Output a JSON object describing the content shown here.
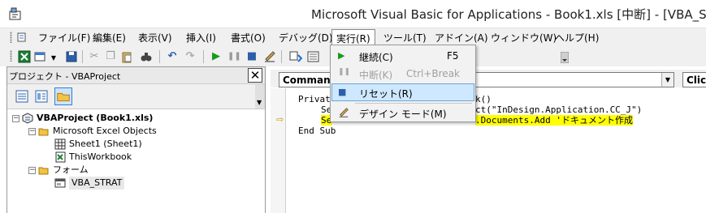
{
  "window": {
    "title": "Microsoft Visual Basic for Applications - Book1.xls [中断] - [VBA_ST"
  },
  "menubar": {
    "items": [
      {
        "label": "ファイル(F)"
      },
      {
        "label": "編集(E)"
      },
      {
        "label": "表示(V)"
      },
      {
        "label": "挿入(I)"
      },
      {
        "label": "書式(O)"
      },
      {
        "label": "デバッグ(D)"
      },
      {
        "label": "実行(R)"
      },
      {
        "label": "ツール(T)"
      },
      {
        "label": "アドイン(A)"
      },
      {
        "label": "ウィンドウ(W)"
      },
      {
        "label": "ヘルプ(H)"
      }
    ],
    "open_menu": "実行(R)"
  },
  "run_menu": {
    "items": [
      {
        "label": "継続(C)",
        "shortcut": "F5",
        "enabled": true,
        "icon": "play-icon"
      },
      {
        "label": "中断(K)",
        "shortcut": "Ctrl+Break",
        "enabled": false,
        "icon": "pause-icon"
      },
      {
        "label": "リセット(R)",
        "shortcut": "",
        "enabled": true,
        "icon": "stop-icon",
        "highlighted": true
      },
      {
        "label": "デザイン モード(M)",
        "shortcut": "",
        "enabled": true,
        "icon": "design-mode-icon"
      }
    ]
  },
  "project_panel": {
    "title": "プロジェクト - VBAProject",
    "tree": {
      "project": "VBAProject (Book1.xls)",
      "excel_objects_folder": "Microsoft Excel Objects",
      "sheet1": "Sheet1 (Sheet1)",
      "thisworkbook": "ThisWorkbook",
      "forms_folder": "フォーム",
      "form1": "VBA_STRAT"
    }
  },
  "code_window": {
    "object_combo": "Command",
    "procedure_combo": "Clic",
    "lines": [
      "Privat",
      "Se",
      "Se",
      "End Sub"
    ],
    "line_tails": [
      "k()",
      "ct(\"InDesign.Application.CC_J\")",
      ".Documents.Add 'ドキュメント作成"
    ]
  },
  "colors": {
    "menubar_bg": "#f0f0f0",
    "highlight_line": "#ffff00",
    "menu_selection": "#cde8ff",
    "exec_arrow": "#c8a000"
  }
}
